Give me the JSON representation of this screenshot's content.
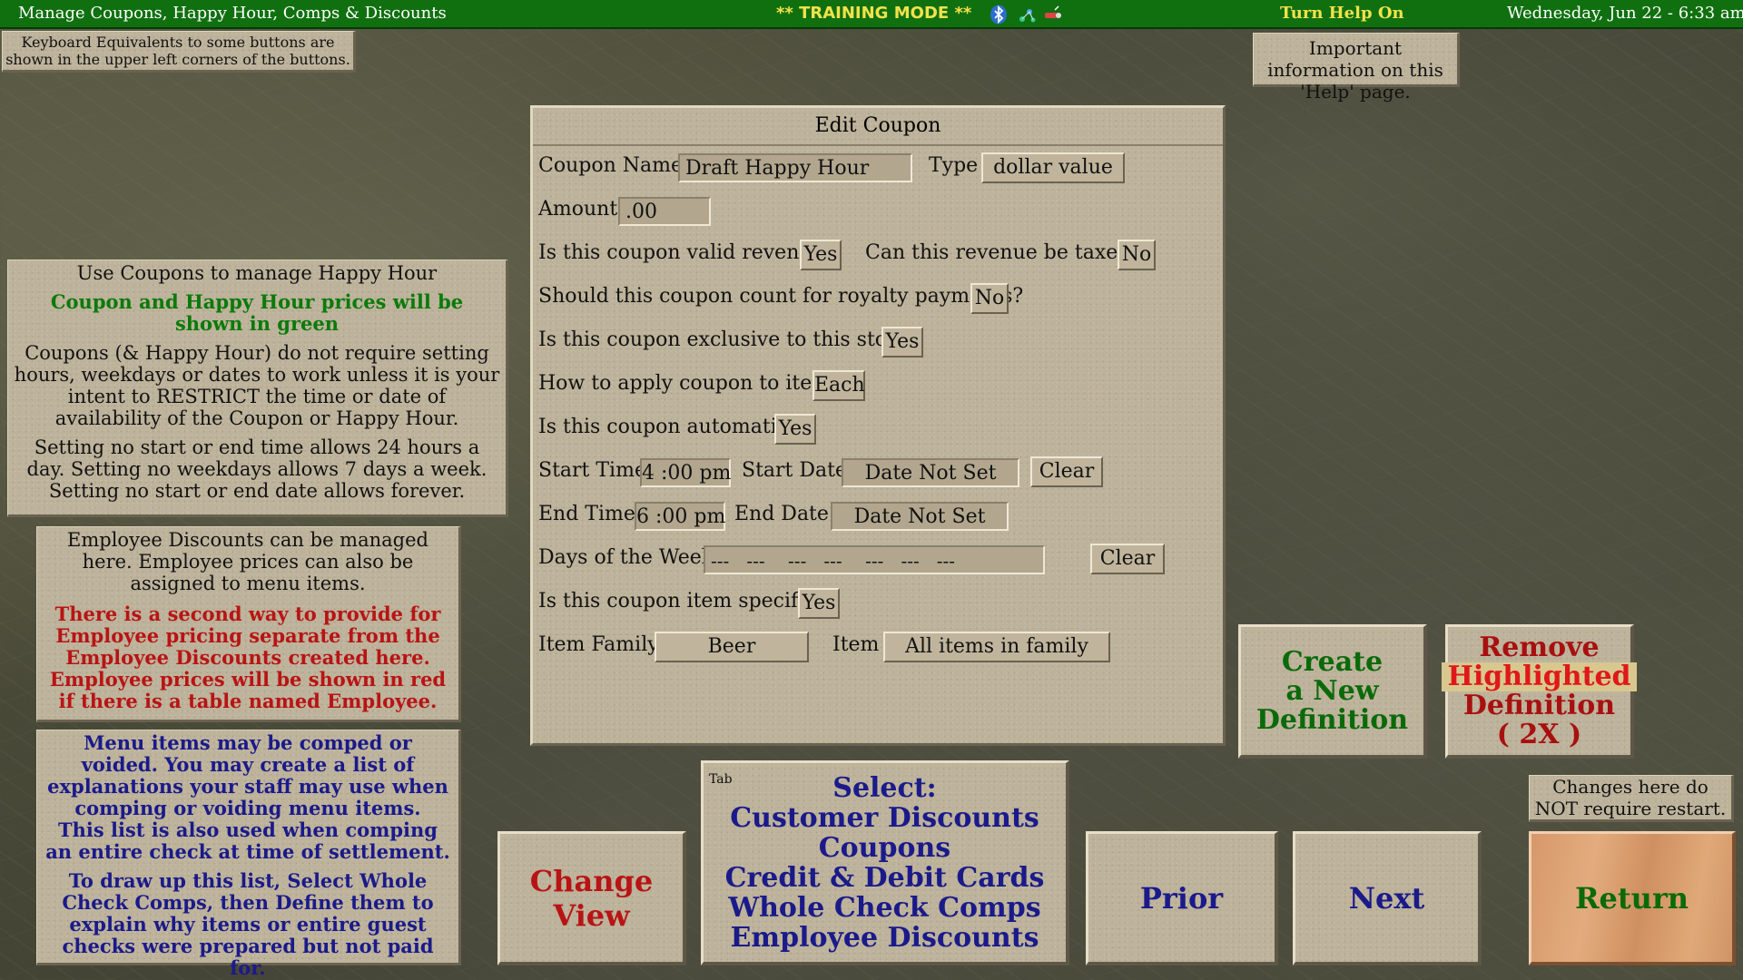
{
  "topbar": {
    "title": "Manage Coupons, Happy Hour, Comps & Discounts",
    "training": "** TRAINING MODE **",
    "help_toggle": "Turn Help On",
    "datetime": "Wednesday, Jun 22 - 6:33 am"
  },
  "notes": {
    "keyboard": "Keyboard Equivalents to some buttons are shown in the upper left corners of the buttons.",
    "help_info": "Important information on this 'Help' page.",
    "restart": "Changes here do NOT require restart."
  },
  "panel_coupons": {
    "title": "Use Coupons to manage Happy Hour",
    "green_note": "Coupon and Happy Hour prices will be shown in green",
    "p1": "Coupons (& Happy Hour) do not require setting hours, weekdays or dates to work unless it is your intent to RESTRICT the time or date of availability of the Coupon or Happy Hour.",
    "p2": "Setting no start or end time allows 24 hours a day. Setting no weekdays allows 7 days a week. Setting no start or end date allows forever."
  },
  "panel_employee": {
    "p1": "Employee Discounts can be managed here. Employee prices can also be assigned to menu items.",
    "red_note": "There is a second way to provide for Employee pricing separate from the Employee Discounts created here. Employee prices will be shown in red if there is a table named Employee."
  },
  "panel_comps": {
    "p1": "Menu items may be comped or voided. You may create a list of explanations your staff may use when comping or voiding menu items.",
    "p2": "This list is also used when comping an entire check at time of settlement.",
    "p3": "To draw up this list, Select Whole Check Comps, then Define them to explain why items or entire guest checks were prepared but not paid for."
  },
  "dialog": {
    "title": "Edit Coupon",
    "coupon_name_label": "Coupon Name",
    "coupon_name_value": "Draft Happy Hour",
    "type_label": "Type",
    "type_value": "dollar value",
    "amount_label": "Amount",
    "amount_value": ".00",
    "valid_revenue_label": "Is this coupon valid revenue?",
    "valid_revenue_value": "Yes",
    "taxed_label": "Can this revenue be taxed?",
    "taxed_value": "No",
    "royalty_label": "Should this coupon count for royalty payments?",
    "royalty_value": "No",
    "exclusive_label": "Is this coupon exclusive to this store?",
    "exclusive_value": "Yes",
    "apply_label": "How to apply coupon to items",
    "apply_value": "Each",
    "automatic_label": "Is this coupon automatic?",
    "automatic_value": "Yes",
    "start_time_label": "Start Time",
    "start_time_value": "4 :00 pm",
    "start_date_label": "Start Date",
    "start_date_value": "Date Not Set",
    "end_time_label": "End Time",
    "end_time_value": "6 :00 pm",
    "end_date_label": "End Date",
    "end_date_value": "Date Not Set",
    "clear_label": "Clear",
    "days_label": "Days of the Week",
    "days_value": "---   ---    ---   ---    ---   ---   ---",
    "item_specific_label": "Is this coupon item specific?",
    "item_specific_value": "Yes",
    "item_family_label": "Item Family",
    "item_family_value": "Beer",
    "item_label": "Item",
    "item_value": "All items in family"
  },
  "buttons": {
    "create": [
      "Create",
      "a New",
      "Definition"
    ],
    "remove": [
      "Remove",
      "Highlighted",
      "Definition",
      "( 2X )"
    ],
    "change_view": "Change View",
    "select_hotkey": "Tab",
    "select": [
      "Select:",
      "Customer Discounts",
      "Coupons",
      "Credit & Debit Cards",
      "Whole Check Comps",
      "Employee Discounts"
    ],
    "prior": "Prior",
    "next": "Next",
    "return": "Return"
  },
  "icons": [
    "bluetooth-icon",
    "network-icon",
    "usb-icon"
  ],
  "colors": {
    "topbar": "#107010",
    "accent_yellow": "#f2e24a",
    "green_text": "#0a7a0a",
    "red_text": "#b81414",
    "blue_text": "#1a1a8a",
    "return_button": "#d9a06a"
  }
}
